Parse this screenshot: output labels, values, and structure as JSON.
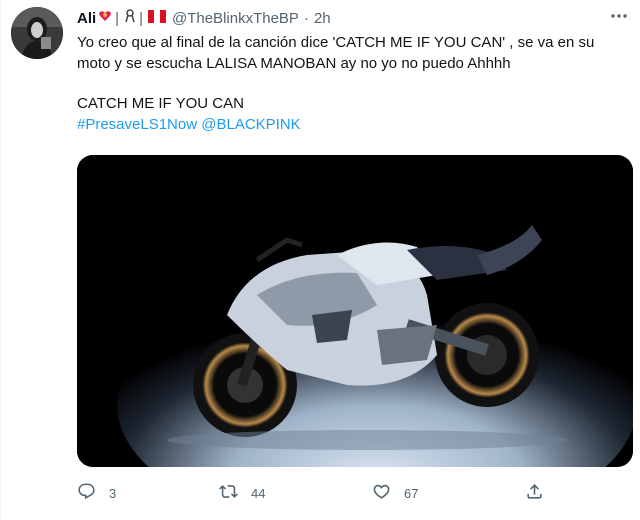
{
  "tweet": {
    "author_name": "Ali",
    "separator_1": "|",
    "separator_2": "|",
    "handle": "@TheBlinkxTheBP",
    "dot": "·",
    "time": "2h",
    "text_line_1": "Yo creo que al final de la canción dice 'CATCH ME IF YOU CAN' , se va en su moto y se escucha LALISA MANOBAN  ay no yo no puedo Ahhhh",
    "text_line_2": "CATCH ME IF YOU CAN",
    "hashtag": "#PresaveLS1Now",
    "mention": "@BLACKPINK",
    "media_description_icon": "motorcycle-photo"
  },
  "actions": {
    "reply_count": "3",
    "retweet_count": "44",
    "like_count": "67"
  },
  "icons": {
    "more": "more-icon",
    "reply": "reply-icon",
    "retweet": "retweet-icon",
    "like": "heart-icon",
    "share": "share-icon"
  },
  "colors": {
    "text": "#0f1419",
    "secondary": "#536471",
    "link": "#1d9bf0"
  }
}
